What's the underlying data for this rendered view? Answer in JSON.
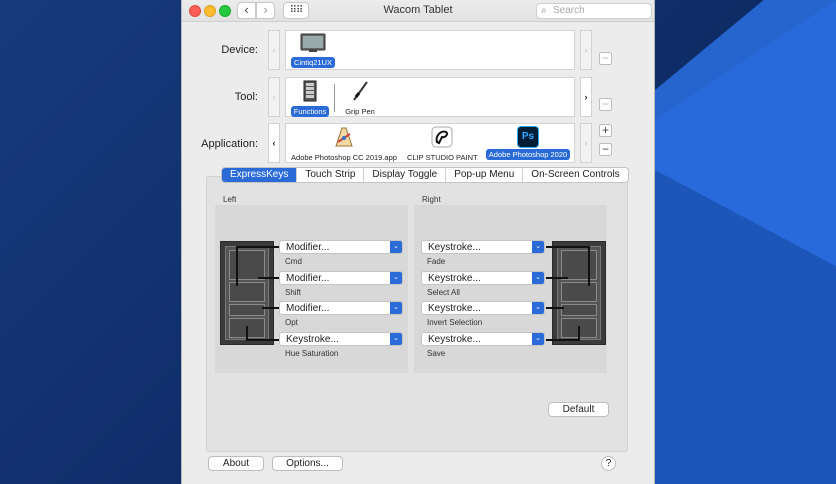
{
  "window": {
    "title": "Wacom Tablet"
  },
  "toolbar": {
    "back_label": "‹",
    "forward_label": "›",
    "grid_label": "⠿⠿",
    "search_placeholder": "Search"
  },
  "device": {
    "label": "Device:",
    "items": [
      {
        "name": "Cintiq21UX",
        "selected": true
      }
    ],
    "remove_label": "−"
  },
  "tool": {
    "label": "Tool:",
    "items": [
      {
        "name": "Functions",
        "selected": true
      },
      {
        "name": "Grip Pen",
        "selected": false
      }
    ],
    "remove_label": "−"
  },
  "application": {
    "label": "Application:",
    "items": [
      {
        "name": "Adobe Photoshop CC 2019.app",
        "selected": false
      },
      {
        "name": "CLIP STUDIO PAINT",
        "selected": false
      },
      {
        "name": "Adobe Photoshop 2020",
        "selected": true
      }
    ],
    "add_label": "+",
    "remove_label": "−",
    "ps_icon_text": "Ps"
  },
  "tabs": [
    {
      "label": "ExpressKeys",
      "active": true
    },
    {
      "label": "Touch Strip",
      "active": false
    },
    {
      "label": "Display Toggle",
      "active": false
    },
    {
      "label": "Pop-up Menu",
      "active": false
    },
    {
      "label": "On-Screen Controls",
      "active": false
    }
  ],
  "left": {
    "heading": "Left",
    "keys": [
      {
        "value": "Modifier...",
        "detail": "Cmd"
      },
      {
        "value": "Modifier...",
        "detail": "Shift"
      },
      {
        "value": "Modifier...",
        "detail": "Opt"
      },
      {
        "value": "Keystroke...",
        "detail": "Hue Saturation"
      }
    ]
  },
  "right": {
    "heading": "Right",
    "keys": [
      {
        "value": "Keystroke...",
        "detail": "Fade"
      },
      {
        "value": "Keystroke...",
        "detail": "Select All"
      },
      {
        "value": "Keystroke...",
        "detail": "Invert Selection"
      },
      {
        "value": "Keystroke...",
        "detail": "Save"
      }
    ]
  },
  "buttons": {
    "default": "Default",
    "about": "About",
    "options": "Options...",
    "help": "?"
  },
  "colors": {
    "accent": "#2a6bd8",
    "window_bg": "#ececec"
  }
}
